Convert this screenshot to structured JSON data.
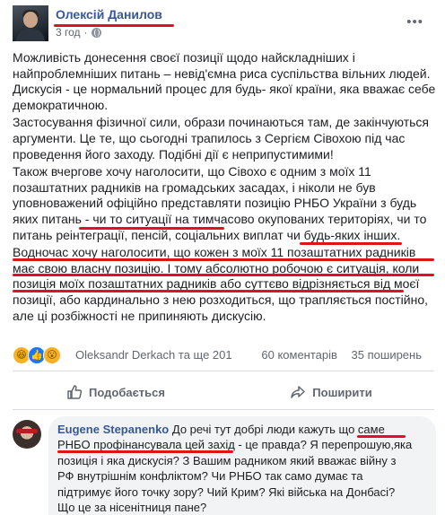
{
  "post": {
    "author": "Олексій Данилов",
    "time": "3 год",
    "privacy_icon": "globe-icon",
    "more_icon": "more-icon",
    "paragraphs": [
      [
        "Можливість донесення своєї позиції щодо найскладніших і",
        "найпроблемніших питань – невід'ємна риса суспільства вільних людей.",
        "Дискусія - це нормальний процес для будь- якої країни, яка вважає себе",
        "демократичною."
      ],
      [
        "Застосування фізичної сили, образи починаються там, де закінчуються",
        "аргументи. Це те, що сьогодні трапилось з Сергієм Сівохою під час",
        "проведення його заходу. Подібні дії є неприпустимими!"
      ],
      [
        "Також вчергове хочу наголосити, що Сівохо є одним з моїх 11",
        "позаштатних радників на громадських засадах, і ніколи не був",
        "уповноважений офіційно представляти позицію РНБО України з будь",
        "яких питань - чи то ситуації на тимчасово окупованих територіях, чи то",
        "питань реінтеграції, пенсій, соціальних виплат чи будь-яких інших."
      ],
      [
        "Водночас хочу наголосити, що кожен з моїх 11 позаштатних радників",
        "має свою власну позицію. І тому абсолютно робочою є ситуація, коли",
        "позиція моїх позаштатних радників або суттєво відрізняється від моєї",
        "позиції, або кардинально з нею розходиться, що трапляється постійно,",
        "але ці розбіжності не припиняють дискусію."
      ]
    ]
  },
  "reactions": {
    "icons": [
      "haha-icon",
      "like-icon",
      "wow-icon"
    ],
    "glyphs": [
      "😆",
      "👍",
      "😮"
    ],
    "names": "Oleksandr Derkach та ще 201",
    "comments": "60 коментарів",
    "shares": "35 поширень"
  },
  "actions": {
    "like": "Подобається",
    "share": "Поширити"
  },
  "comment": {
    "author": "Eugene Stepanenko",
    "lines": [
      "До речі тут добрі люди кажуть що саме",
      "РНБО профінансувала цей захід - це правда? Я перепрошую,яка",
      "позиція і яка дискусія? З Вашим радником який вважає війну з",
      "РФ внутрішнім конфліктом? Чи РНБО так само думає та",
      "підтримує його точку зору? Чий Крим? Які війська на Донбасі?",
      "Що це за нісенітниця пане?"
    ]
  },
  "colors": {
    "link": "#385898",
    "highlight_underline": "#e0121f",
    "secondary_text": "#606770"
  }
}
